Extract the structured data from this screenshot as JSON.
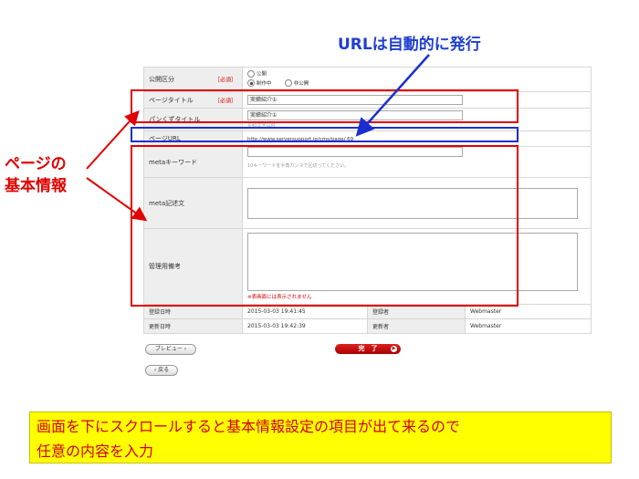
{
  "annotations": {
    "top_caption": "URLは自動的に発行",
    "left_caption_line1": "ページの",
    "left_caption_line2": "基本情報",
    "bottom_caption_line1": "画面を下にスクロールすると基本情報設定の項目が出て来るので",
    "bottom_caption_line2": "任意の内容を入力"
  },
  "form": {
    "required_mark": "［必須］",
    "publish": {
      "label": "公開区分",
      "option_public": "公開",
      "option_draft": "制作中",
      "option_private": "非公開",
      "selected": "制作中"
    },
    "page_title": {
      "label": "ページタイトル",
      "value": "実績紹介①"
    },
    "breadcrumb_title": {
      "label": "パンくずタイトル",
      "value": "実績紹介①",
      "hint": "※40文字以内"
    },
    "page_url": {
      "label": "ページURL",
      "value": "http://www.serversupport.jp/cms/page/ 69"
    },
    "meta_keywords": {
      "label": "metaキーワード",
      "hint": "10キーワードを半角カンマで区切ってください。"
    },
    "meta_description": {
      "label": "meta記述文"
    },
    "admin_notes": {
      "label": "管理用備考",
      "note": "※表画面には表示されません"
    }
  },
  "meta": {
    "registered_at_label": "登録日時",
    "registered_at": "2015-03-03 19:41:45",
    "registered_by_label": "登録者",
    "registered_by": "Webmaster",
    "updated_at_label": "更新日時",
    "updated_at": "2015-03-03 19:42:39",
    "updated_by_label": "更新者",
    "updated_by": "Webmaster"
  },
  "buttons": {
    "preview": "プレビュー",
    "done": "完　了",
    "back": "戻る"
  },
  "colors": {
    "annotation_red": "#e00000",
    "annotation_blue": "#1a2fd0",
    "caption_bg": "#ffff00",
    "done_button": "#c00000"
  }
}
